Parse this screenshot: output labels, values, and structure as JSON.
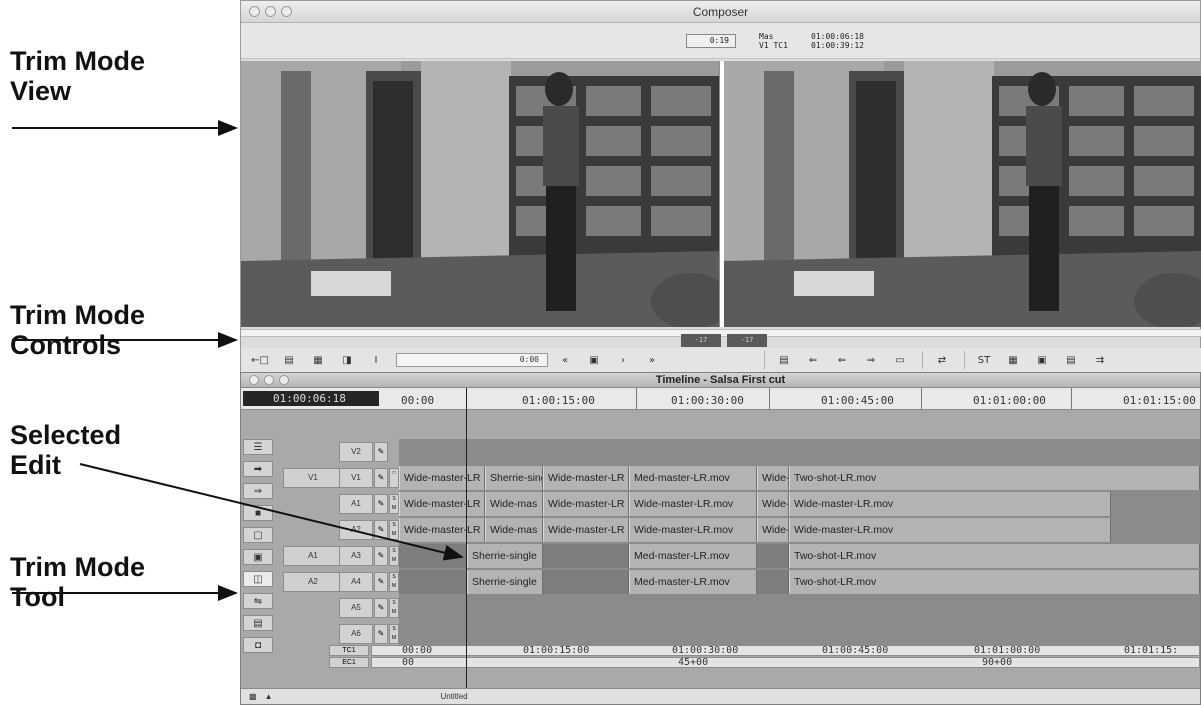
{
  "annotations": [
    {
      "line1": "Trim Mode",
      "line2": "View"
    },
    {
      "line1": "Trim Mode",
      "line2": "Controls"
    },
    {
      "line1": "Selected",
      "line2": "Edit"
    },
    {
      "line1": "Trim Mode",
      "line2": "Tool"
    }
  ],
  "composer": {
    "title": "Composer",
    "duration": "0:19",
    "tc_label_top": "Mas",
    "tc_label_bottom": "V1 TC1",
    "tc_top": "01:00:06:18",
    "tc_bottom": "01:00:39:12",
    "frame_counters": [
      "-17",
      "-17"
    ],
    "controls": {
      "field_value": "0:00",
      "buttons": [
        "←□",
        "▤",
        "▦",
        "◨",
        "I",
        "«",
        "▣",
        "›",
        "»",
        "▤",
        "⇐",
        "⇐",
        "⇒",
        "▭",
        "⇄",
        "ST",
        "▦",
        "▣",
        "▤",
        "⇉"
      ]
    }
  },
  "timeline": {
    "title": "Timeline - Salsa First cut",
    "master_tc": "01:00:06:18",
    "ruler_labels": [
      "00:00",
      "01:00:15:00",
      "01:00:30:00",
      "01:00:45:00",
      "01:01:00:00",
      "01:01:15:00"
    ],
    "tracks": [
      {
        "name": "V2",
        "source": ""
      },
      {
        "name": "V1",
        "source": "V1"
      },
      {
        "name": "A1",
        "source": ""
      },
      {
        "name": "A2",
        "source": ""
      },
      {
        "name": "A3",
        "source": "A1"
      },
      {
        "name": "A4",
        "source": "A2"
      },
      {
        "name": "A5",
        "source": ""
      },
      {
        "name": "A6",
        "source": ""
      }
    ],
    "v1_clips": [
      "Wide-master-LR",
      "Sherrie-single",
      "Wide-master-LR",
      "Med-master-LR.mov",
      "Wide-",
      "Two-shot-LR.mov"
    ],
    "a1_clips": [
      "Wide-master-LR",
      "Wide-mas",
      "Wide-master-LR",
      "Wide-master-LR.mov",
      "Wide-",
      "Wide-master-LR.mov"
    ],
    "a2_clips": [
      "Wide-master-LR",
      "Wide-mas",
      "Wide-master-LR",
      "Wide-master-LR.mov",
      "Wide-",
      "Wide-master-LR.mov"
    ],
    "a3_clips": [
      "Sherrie-single",
      "Med-master-LR.mov",
      "Two-shot-LR.mov"
    ],
    "a4_clips": [
      "Sherrie-single",
      "Med-master-LR.mov",
      "Two-shot-LR.mov"
    ],
    "tc1_label": "TC1",
    "ec1_label": "EC1",
    "tc1_values": [
      "00:00",
      "01:00:15:00",
      "01:00:30:00",
      "01:00:45:00",
      "01:01:00:00",
      "01:01:15:"
    ],
    "ec1_values": [
      "00",
      "45+00",
      "90+00"
    ],
    "status_text": "Untitled"
  }
}
